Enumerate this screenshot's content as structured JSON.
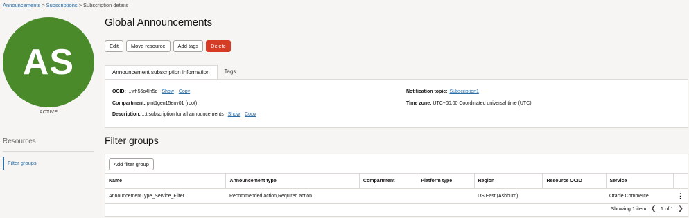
{
  "breadcrumb": {
    "items": [
      {
        "label": "Announcements"
      },
      {
        "label": "Subscriptions"
      },
      {
        "label": "Subscription details"
      }
    ],
    "separator": ">"
  },
  "resource": {
    "initials": "AS",
    "state": "ACTIVE",
    "avatar_color": "#4b8a2a"
  },
  "page": {
    "title": "Global Announcements"
  },
  "actions": {
    "edit": "Edit",
    "move": "Move resource",
    "add_tags": "Add tags",
    "delete": "Delete"
  },
  "tabs": [
    {
      "label": "Announcement subscription information",
      "active": true
    },
    {
      "label": "Tags",
      "active": false
    }
  ],
  "info": {
    "ocid_label": "OCID:",
    "ocid_value": "...wh56o4ln5q",
    "show": "Show",
    "copy": "Copy",
    "compartment_label": "Compartment:",
    "compartment_value": "pint1gen15env01 (root)",
    "description_label": "Description:",
    "description_value": "...t subscription for all announcements",
    "topic_label": "Notification topic:",
    "topic_value": "Subscription1",
    "timezone_label": "Time zone:",
    "timezone_value": "UTC+00:00 Coordinated universal time (UTC)"
  },
  "resources": {
    "title": "Resources",
    "items": [
      {
        "label": "Filter groups"
      }
    ]
  },
  "filter_groups": {
    "title": "Filter groups",
    "add_button": "Add filter group",
    "columns": [
      "Name",
      "Announcement type",
      "Compartment",
      "Platform type",
      "Region",
      "Resource OCID",
      "Service"
    ],
    "rows": [
      {
        "name": "AnnouncementType_Service_Filter",
        "announcement_type": "Recommended action,Required action",
        "compartment": "",
        "platform_type": "",
        "region": "US East (Ashburn)",
        "resource_ocid": "",
        "service": "Oracle Commerce"
      }
    ],
    "showing": "Showing 1 item",
    "page_label": "1 of 1"
  },
  "colors": {
    "accent": "#2b6ea8",
    "danger": "#d63b25",
    "background": "#f6f5f3"
  }
}
